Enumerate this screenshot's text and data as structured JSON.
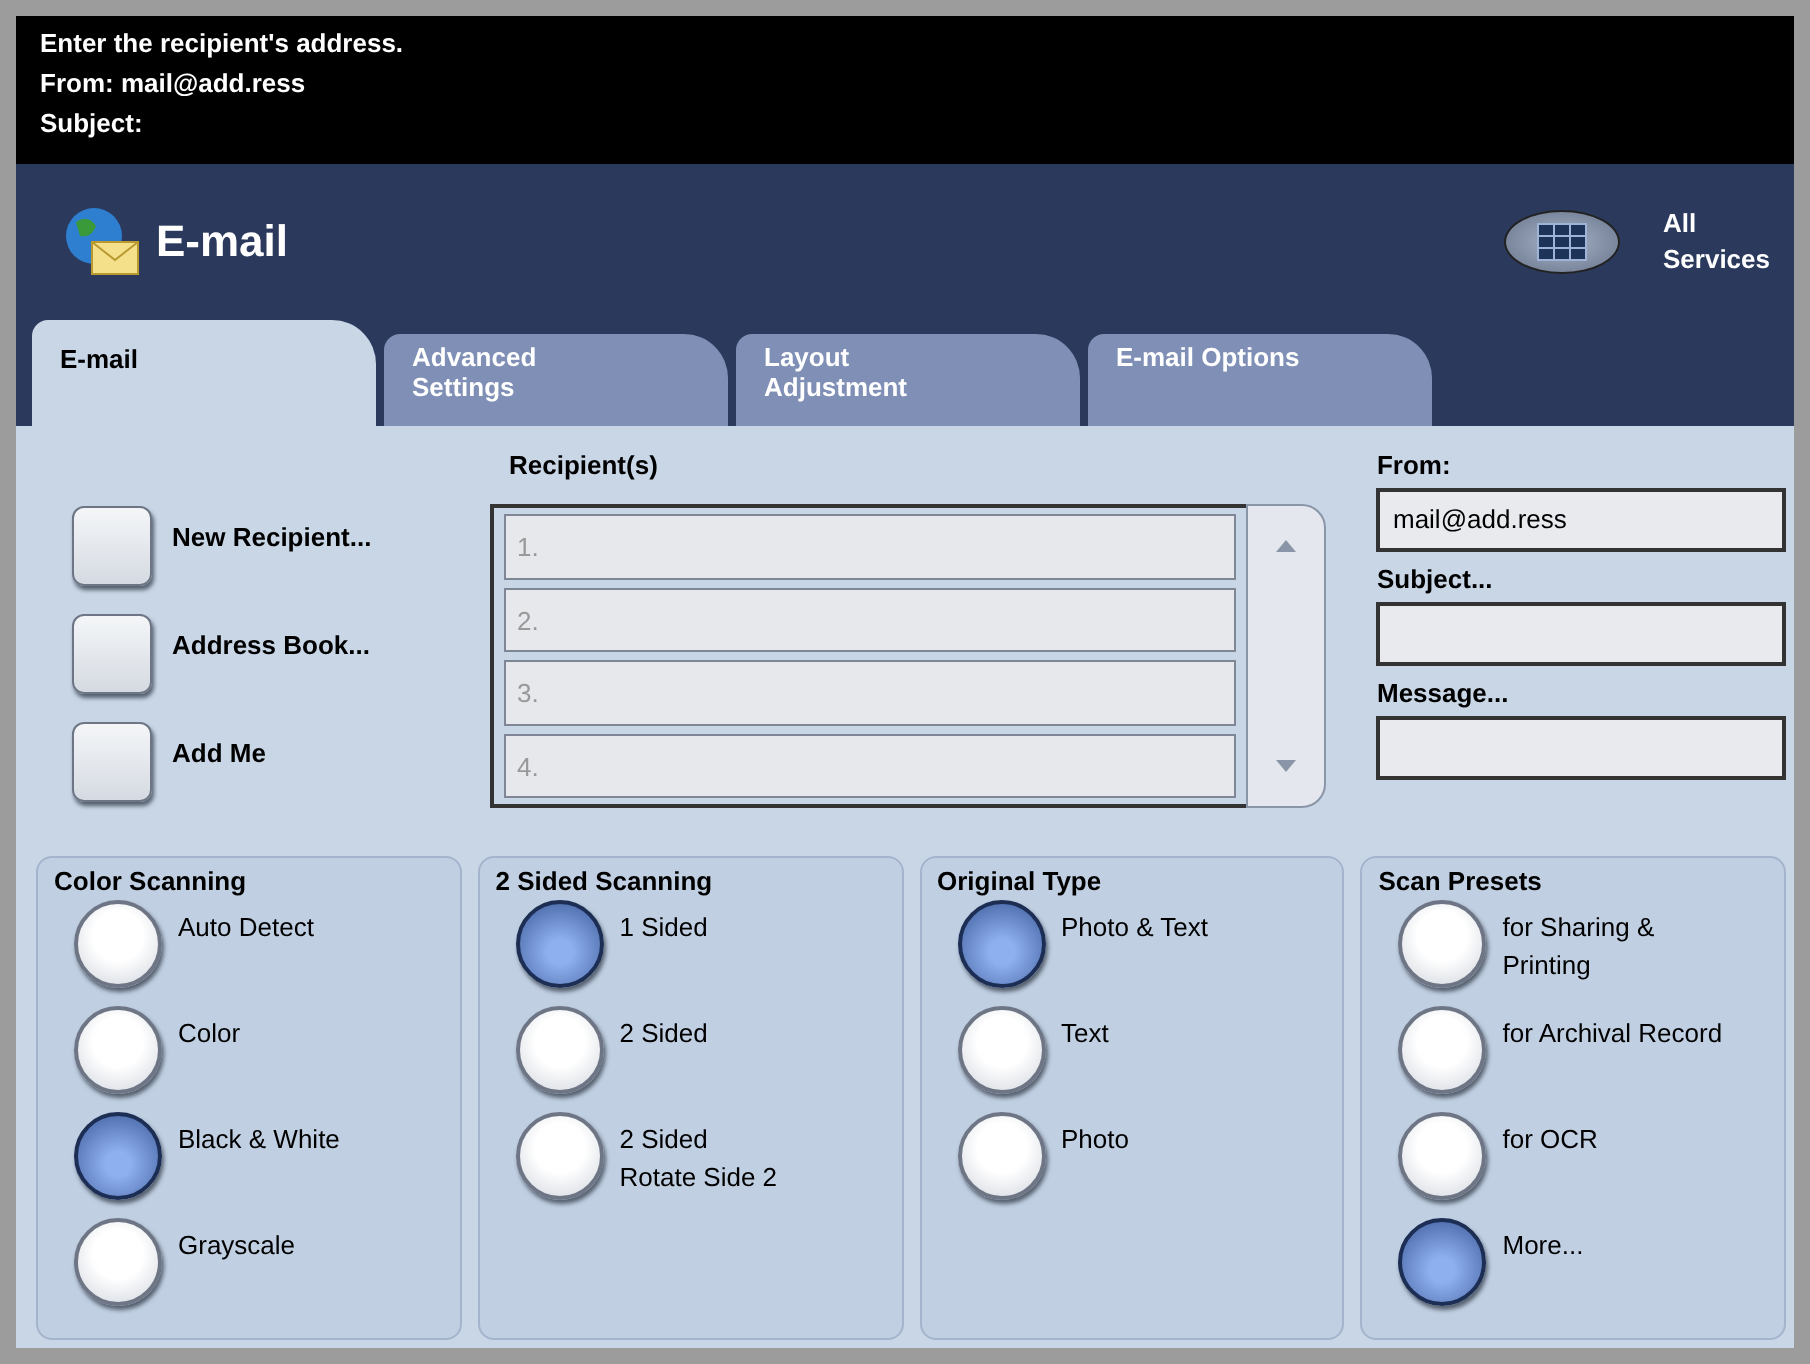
{
  "message_area": {
    "lines": [
      "Enter the recipient's address.",
      "From: mail@add.ress",
      "Subject:"
    ]
  },
  "header": {
    "title": "E-mail",
    "all_services": "All\nServices"
  },
  "tabs": [
    {
      "label": "E-mail",
      "selected": true
    },
    {
      "label": "Advanced\nSettings",
      "selected": false
    },
    {
      "label": "Layout\nAdjustment",
      "selected": false
    },
    {
      "label": "E-mail Options",
      "selected": false
    }
  ],
  "actions": [
    "New Recipient...",
    "Address Book...",
    "Add Me"
  ],
  "recipients": {
    "heading": "Recipient(s)",
    "rows": [
      "1.",
      "2.",
      "3.",
      "4."
    ]
  },
  "from": {
    "label": "From:",
    "value": "mail@add.ress"
  },
  "subject": {
    "label": "Subject..."
  },
  "message": {
    "label": "Message..."
  },
  "groups": [
    {
      "title": "Color Scanning",
      "options": [
        {
          "label": "Auto Detect",
          "selected": false
        },
        {
          "label": "Color",
          "selected": false
        },
        {
          "label": "Black & White",
          "selected": true
        },
        {
          "label": "Grayscale",
          "selected": false
        }
      ]
    },
    {
      "title": "2 Sided Scanning",
      "options": [
        {
          "label": "1 Sided",
          "selected": true
        },
        {
          "label": "2 Sided",
          "selected": false
        },
        {
          "label": "2 Sided\nRotate Side 2",
          "selected": false
        }
      ]
    },
    {
      "title": "Original Type",
      "options": [
        {
          "label": "Photo & Text",
          "selected": true
        },
        {
          "label": "Text",
          "selected": false
        },
        {
          "label": "Photo",
          "selected": false
        }
      ]
    },
    {
      "title": "Scan Presets",
      "options": [
        {
          "label": "for Sharing &\nPrinting",
          "selected": false
        },
        {
          "label": "for Archival Record",
          "selected": false
        },
        {
          "label": "for OCR",
          "selected": false
        },
        {
          "label": "More...",
          "selected": true
        }
      ]
    }
  ]
}
